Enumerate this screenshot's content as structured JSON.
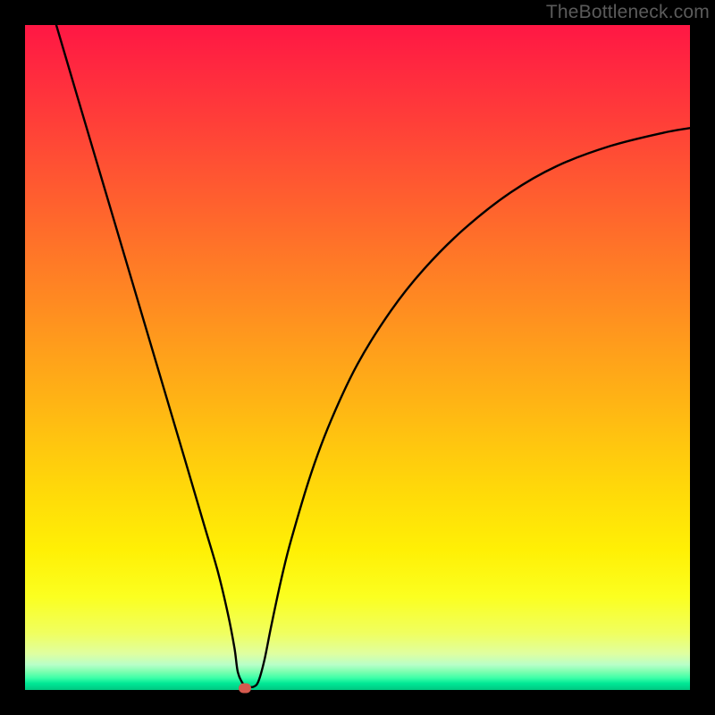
{
  "watermark": "TheBottleneck.com",
  "chart_data": {
    "type": "line",
    "title": "",
    "xlabel": "",
    "ylabel": "",
    "xlim": [
      0,
      100
    ],
    "ylim": [
      0,
      100
    ],
    "grid": false,
    "legend": false,
    "background": "rainbow-vertical-gradient",
    "series": [
      {
        "name": "bottleneck-curve",
        "color": "#000000",
        "x": [
          4.7,
          8,
          12,
          16,
          20,
          24,
          27,
          29,
          30.5,
          31.5,
          32,
          32.8,
          33.5,
          34.4,
          35.1,
          36,
          37,
          38.5,
          40,
          43,
          46,
          50,
          55,
          60,
          66,
          73,
          80,
          88,
          96,
          100
        ],
        "y": [
          100,
          88.8,
          75.3,
          61.8,
          48.3,
          34.8,
          24.6,
          17.8,
          11.5,
          6.3,
          2.7,
          0.9,
          0.5,
          0.5,
          1.3,
          4.5,
          9.5,
          16.5,
          22.5,
          32.5,
          40.5,
          49,
          57,
          63.3,
          69.3,
          74.8,
          78.8,
          81.8,
          83.8,
          84.5
        ]
      }
    ],
    "marker": {
      "x": 33.1,
      "y": 0.3,
      "color": "#d55a4e"
    }
  }
}
